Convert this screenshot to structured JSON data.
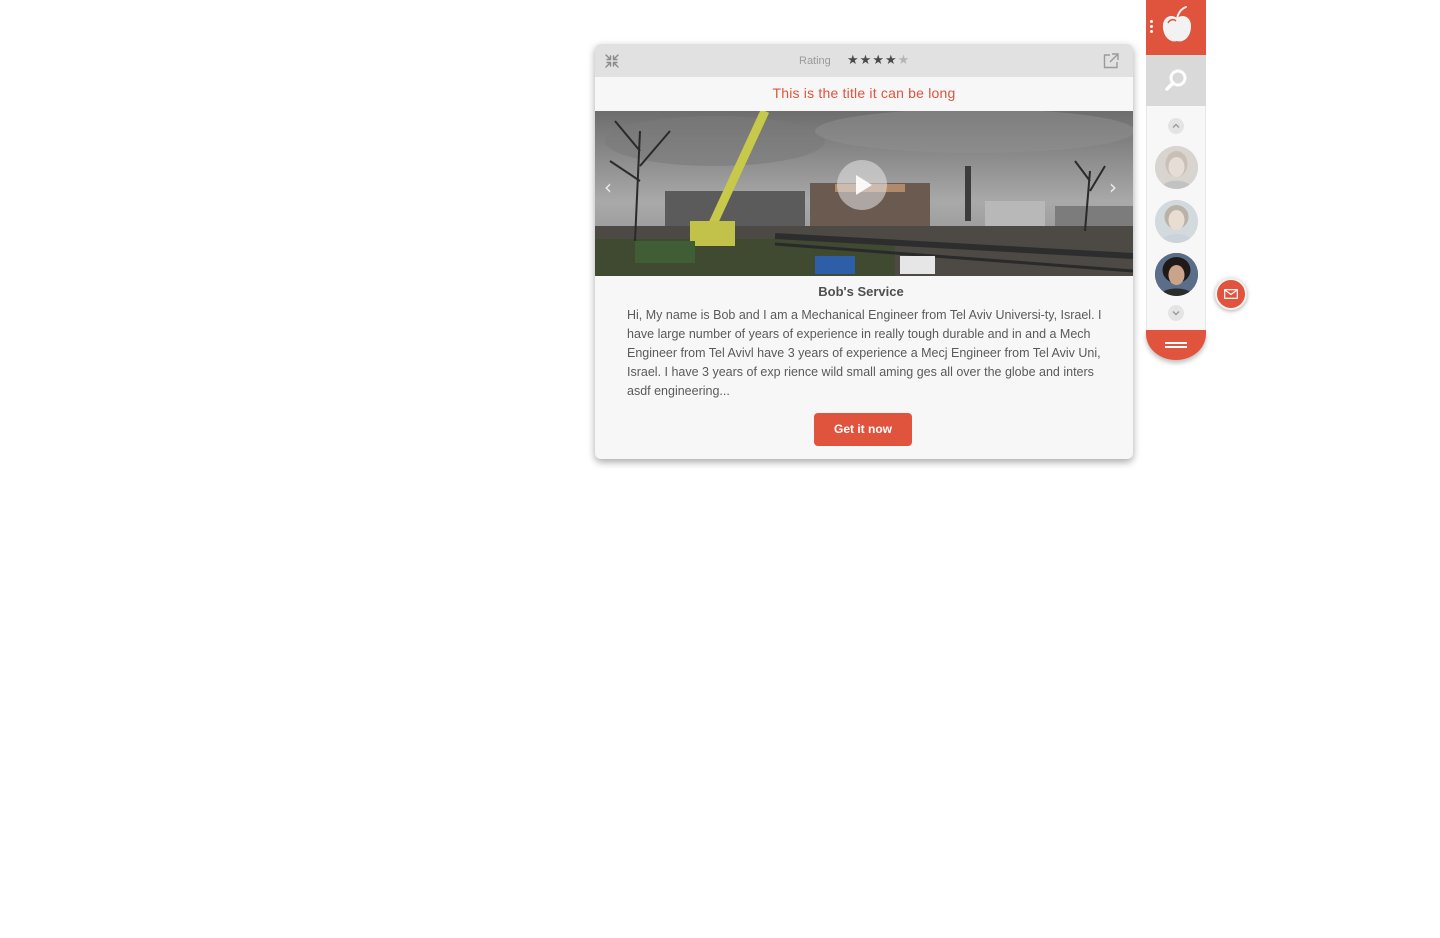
{
  "card": {
    "rating_label": "Rating",
    "rating": {
      "value": 4,
      "max": 5
    },
    "title": "This is the title it can be long",
    "service_name": "Bob's Service",
    "description": "Hi, My name is Bob and I am a Mechanical Engineer from Tel Aviv Universi-ty, Israel. I have large number of years of experience in really tough durable and  in  and  a Mech Engineer from Tel Avivl have 3 years of experience a Mecj Engineer from Tel Aviv Uni, Israel. I have 3 years of exp rience wild small aming ges all over the globe and inters asdf engineering...",
    "cta_label": "Get it now",
    "icons": {
      "collapse": "collapse-arrows-icon",
      "external": "open-external-icon",
      "play": "play-icon",
      "prev": "chevron-left-icon",
      "next": "chevron-right-icon"
    }
  },
  "sidebar": {
    "icons": {
      "logo": "apple-logo-icon",
      "search": "search-icon",
      "scroll_up": "chevron-up-icon",
      "scroll_down": "chevron-down-icon",
      "menu": "menu-lines-icon",
      "drag": "drag-dots-icon"
    },
    "avatars": [
      "avatar-older-woman",
      "avatar-woman",
      "avatar-man-curly-hair"
    ]
  },
  "floating": {
    "mail_icon": "mail-envelope-icon"
  },
  "colors": {
    "accent": "#e0533d",
    "card_background": "#f7f7f7",
    "header_background": "#e1e1e1",
    "search_tile": "#d9d9d9"
  }
}
